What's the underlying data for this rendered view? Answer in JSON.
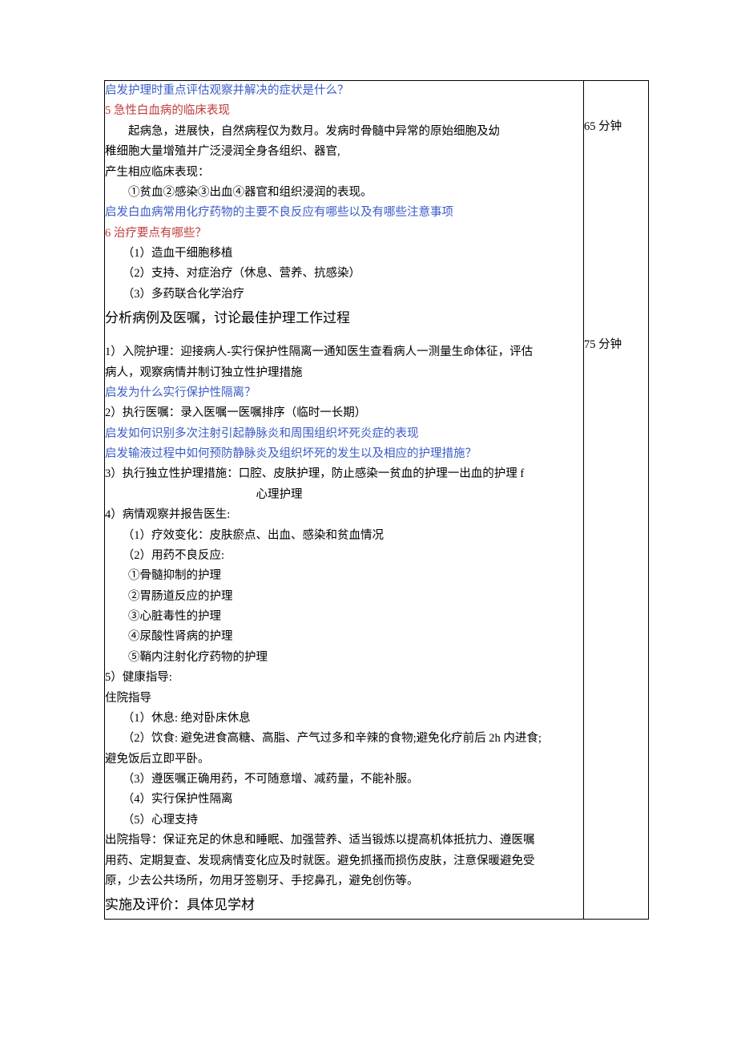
{
  "side": {
    "t1": "65 分钟",
    "t2": "75 分钟"
  },
  "c": {
    "l01": "启发护理时重点评估观察并解决的症状是什么？",
    "l02": "5 急性白血病的临床表现",
    "l03": "起病急，进展快，自然病程仅为数月。发病时骨髓中异常的原始细胞及幼",
    "l04": "稚细胞大量增殖并广泛浸润全身各组织、器官,",
    "l05": "产生相应临床表现：",
    "l06": "①贫血②感染③出血④器官和组织浸润的表现。",
    "l07": "启发白血病常用化疗药物的主要不良反应有哪些以及有哪些注意事项",
    "l08": "6 治疗要点有哪些？",
    "l09": "（1）造血干细胞移植",
    "l10": "（2）支持、对症治疗（休息、营养、抗感染）",
    "l11": "（3）多药联合化学治疗",
    "l12": "分析病例及医嘱，讨论最佳护理工作过程",
    "l13a": "1）入院护理：迎接病人-实行保护性隔离一通知医生查看病人一测量生命体征，评估",
    "l13b": "病人，观察病情并制订独立性护理措施",
    "l14": "启发为什么实行保护性隔离？",
    "l15": "2）执行医嘱：录入医嘱一医嘱排序（临时一长期）",
    "l16": "启发如何识别多次注射引起静脉炎和周围组织坏死炎症的表现",
    "l17": "启发输液过程中如何预防静脉炎及组织坏死的发生以及相应的护理措施？",
    "l18a": "3）执行独立性护理措施：口腔、皮肤护理，防止感染一贫血的护理一出血的护理 f",
    "l18b": "心理护理",
    "l19": "4）病情观察并报告医生:",
    "l20": "（1）疗效变化：皮肤瘀点、出血、感染和贫血情况",
    "l21": "（2）用药不良反应:",
    "l22": "①骨髓抑制的护理",
    "l23": "②胃肠道反应的护理",
    "l24": "③心脏毒性的护理",
    "l25": "④尿酸性肾病的护理",
    "l26": "⑤鞘内注射化疗药物的护理",
    "l27": "5）健康指导:",
    "l28": "住院指导",
    "l29": "（1）休息: 绝对卧床休息",
    "l30": "（2）饮食: 避免进食高糖、高脂、产气过多和辛辣的食物;避免化疗前后 2h 内进食;",
    "l31": "避免饭后立即平卧。",
    "l32": "（3）遵医嘱正确用药，不可随意增、减药量，不能补服。",
    "l33": "（4）实行保护性隔离",
    "l34": "（5）心理支持",
    "l35": "出院指导：保证充足的休息和睡眠、加强营养、适当锻炼以提高机体抵抗力、遵医嘱",
    "l36": "用药、定期复查、发现病情变化应及时就医。避免抓搔而损伤皮肤，注意保暖避免受",
    "l37": "原，少去公共场所，勿用牙签剔牙、手挖鼻孔，避免创伤等。",
    "l38": "实施及评价：具体见学材"
  }
}
